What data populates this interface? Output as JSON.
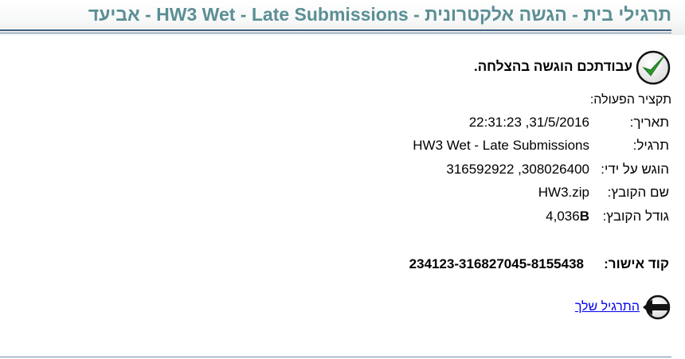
{
  "page": {
    "title": "תרגילי בית - הגשה אלקטרונית - HW3 Wet - Late Submissions - אביעד"
  },
  "result": {
    "success_message": "עבודתכם הוגשה בהצלחה.",
    "summary_label": "תקציר הפעולה:"
  },
  "details": [
    {
      "label": "תאריך:",
      "value": "31/5/2016, 22:31:23"
    },
    {
      "label": "תרגיל:",
      "value": "HW3 Wet - Late Submissions"
    },
    {
      "label": "הוגש על ידי:",
      "value": "308026400, 316592922"
    },
    {
      "label": "שם הקובץ:",
      "value": "HW3.zip"
    },
    {
      "label": "גודל הקובץ:",
      "value": "4,036",
      "unit": "B"
    }
  ],
  "confirmation": {
    "label": "קוד אישור:",
    "code": "234123-316827045-8155438"
  },
  "back": {
    "link_text": "התרגיל שלך"
  },
  "colors": {
    "title": "#5b8f94",
    "rule": "#3e5f7e",
    "link": "#0000ee",
    "check_green": "#2a9a2a"
  },
  "icons": {
    "success": "check-circle-icon",
    "back": "arrow-left-circle-icon"
  }
}
